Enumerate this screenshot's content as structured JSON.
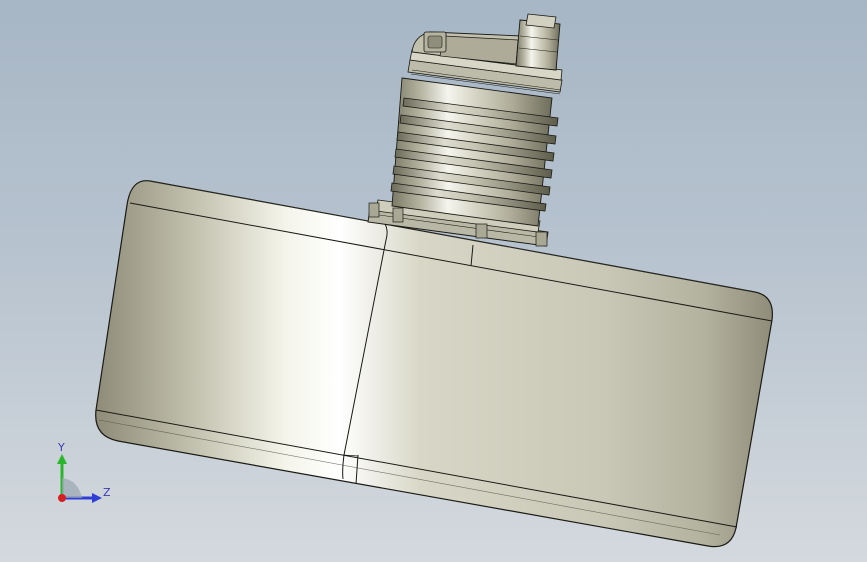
{
  "viewport": {
    "background_top": "#a7b6c5",
    "background_bottom": "#d4d9de"
  },
  "model": {
    "surface_color": "#c9c8b8",
    "edge_color": "#1a1a14"
  },
  "triad": {
    "y_label": "Y",
    "z_label": "Z",
    "y_color": "#2bb52b",
    "z_color": "#2f3fd6",
    "x_color": "#d42020",
    "label_color": "#3a3ab0"
  }
}
